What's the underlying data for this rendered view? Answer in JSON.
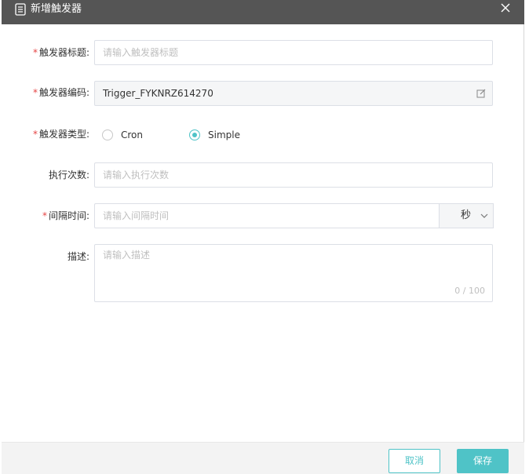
{
  "dialog": {
    "title": "新增触发器",
    "icons": {
      "title_icon": "document-icon",
      "close_icon": "close-icon"
    }
  },
  "form": {
    "title_field": {
      "required": "*",
      "label": "触发器标题:",
      "placeholder": "请输入触发器标题",
      "value": ""
    },
    "code_field": {
      "required": "*",
      "label": "触发器编码:",
      "value": "Trigger_FYKNRZ614270",
      "icon": "edit-icon"
    },
    "type_field": {
      "required": "*",
      "label": "触发器类型:",
      "options": [
        {
          "label": "Cron",
          "checked": false
        },
        {
          "label": "Simple",
          "checked": true
        }
      ]
    },
    "count_field": {
      "label": "执行次数:",
      "placeholder": "请输入执行次数",
      "value": ""
    },
    "interval_field": {
      "required": "*",
      "label": "间隔时间:",
      "placeholder": "请输入间隔时间",
      "value": "",
      "unit": "秒",
      "unit_icon": "chevron-down-icon"
    },
    "desc_field": {
      "label": "描述:",
      "placeholder": "请输入描述",
      "value": "",
      "counter": "0 / 100"
    }
  },
  "footer": {
    "cancel_label": "取消",
    "save_label": "保存"
  },
  "colors": {
    "accent": "#4fc3c7",
    "header_bg": "#555555",
    "required": "#e54545"
  }
}
